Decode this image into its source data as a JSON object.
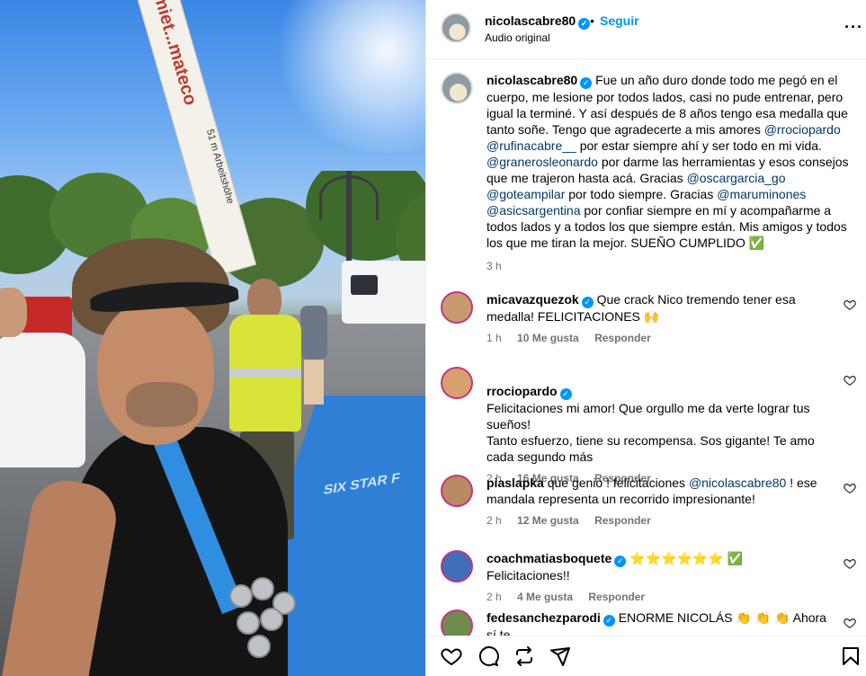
{
  "photo": {
    "crane_text": "miet...mateco",
    "crane_sub": "51 m Arbeitshöhe",
    "carpet_text": "SIX STAR F"
  },
  "header": {
    "username": "nicolascabre80",
    "follow": "Seguir",
    "separator": "•",
    "audio": "Audio original",
    "more_icon": "more-horizontal-icon"
  },
  "caption": {
    "username": "nicolascabre80",
    "parts": [
      {
        "t": "Fue un año duro donde todo me pegó en el cuerpo, me lesione por todos lados, casi no pude entrenar, pero igual la terminé. Y así después de 8 años tengo esa medalla que tanto soñe. Tengo que agradecerte a mis amores "
      },
      {
        "m": "@rrociopardo"
      },
      {
        "t": " "
      },
      {
        "m": "@rufinacabre__"
      },
      {
        "t": " por estar siempre ahí y ser todo en mi vida. "
      },
      {
        "m": "@granerosleonardo"
      },
      {
        "t": " por darme las herramientas y esos consejos que me trajeron hasta acá. Gracias "
      },
      {
        "m": "@oscargarcia_go"
      },
      {
        "t": " "
      },
      {
        "m": "@goteampilar"
      },
      {
        "t": " por todo siempre. Gracias "
      },
      {
        "m": "@maruminones"
      },
      {
        "t": " "
      },
      {
        "m": "@asicsargentina"
      },
      {
        "t": " por confiar siempre en mí y acompañarme a todos lados y a todos los que siempre están. Mis amigos y todos los que me tiran la mejor. SUEÑO CUMPLIDO ✅"
      }
    ],
    "time": "3 h"
  },
  "comments": [
    {
      "username": "micavazquezok",
      "verified": true,
      "text": "Que crack Nico tremendo tener esa medalla! FELICITACIONES 🙌",
      "time": "1 h",
      "likes": "10 Me gusta",
      "reply": "Responder",
      "avatar_color": "#c99a6e"
    },
    {
      "username": "rrociopardo",
      "verified": true,
      "text": "Felicitaciones mi amor! Que orgullo me da verte lograr tus sueños!\nTanto esfuerzo, tiene su recompensa. Sos gigante! Te amo cada segundo más",
      "time": "2 h",
      "likes": "16 Me gusta",
      "reply": "Responder",
      "avatar_color": "#d7a06d"
    },
    {
      "username": "piaslapka",
      "verified": false,
      "text_before": "que genio ! felicitaciones ",
      "mention": "@nicolascabre80",
      "text_after": " ! ese mandala representa un recorrido impresionante!",
      "time": "2 h",
      "likes": "12 Me gusta",
      "reply": "Responder",
      "avatar_color": "#b98a63"
    },
    {
      "username": "coachmatiasboquete",
      "verified": true,
      "text": "⭐⭐⭐⭐⭐⭐ ✅ Felicitaciones!!",
      "time": "2 h",
      "likes": "4 Me gusta",
      "reply": "Responder",
      "avatar_color": "#3f6fb8"
    },
    {
      "username": "fedesanchezparodi",
      "verified": true,
      "text": "ENORME NICOLÁS 👏 👏 👏  Ahora sí te",
      "avatar_color": "#6e8c4c"
    }
  ],
  "actions": {
    "like": "heart-icon",
    "comment": "comment-icon",
    "share": "repost-icon",
    "send": "send-icon",
    "save": "bookmark-icon"
  },
  "colors": {
    "link": "#00376b",
    "follow": "#0095f6",
    "muted": "#737373",
    "verified": "#0095f6"
  }
}
